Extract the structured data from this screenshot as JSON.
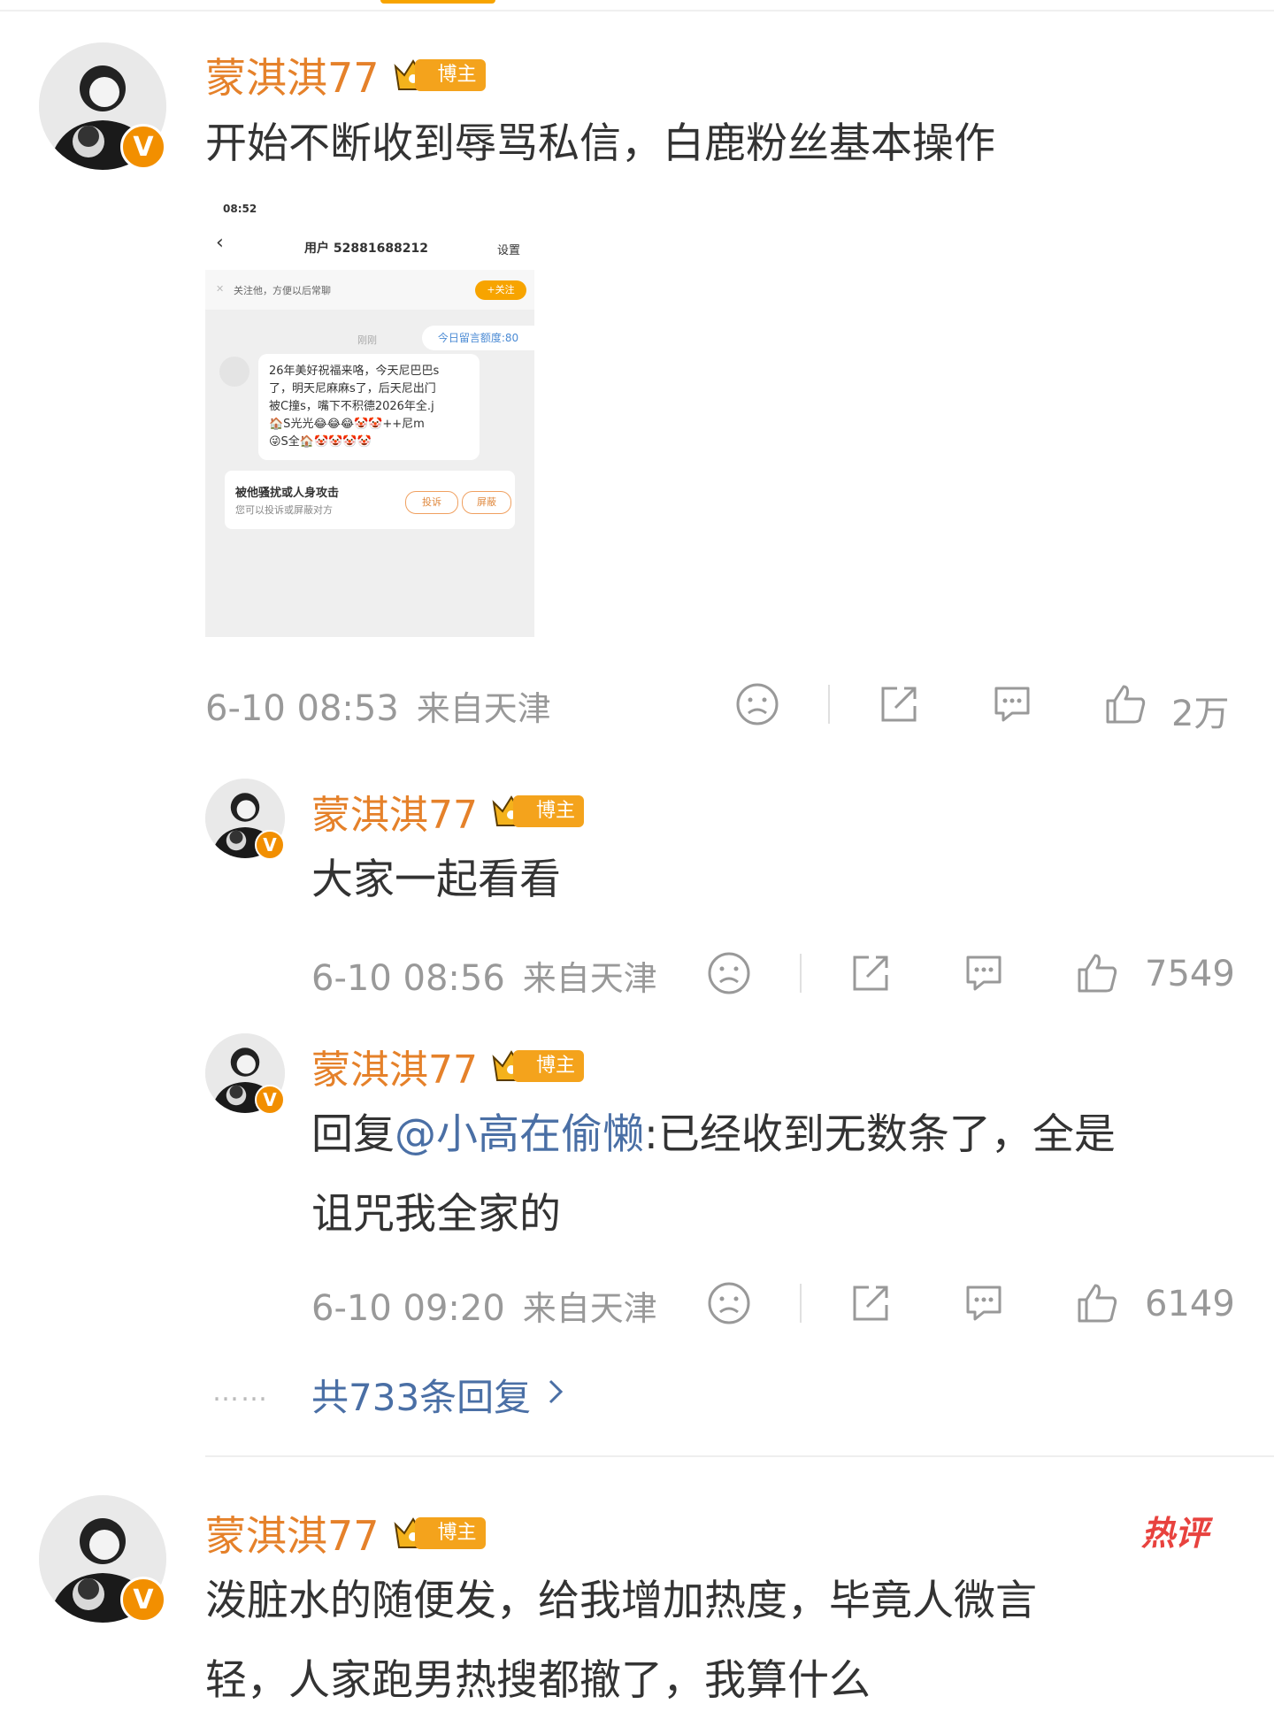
{
  "comments": [
    {
      "username": "蒙淇淇77",
      "badge": "博主",
      "verified": "V",
      "text": "开始不断收到辱骂私信，白鹿粉丝基本操作",
      "time": "6-10 08:53",
      "location": "来自天津",
      "likes": "2万"
    }
  ],
  "embedded_screenshot": {
    "time": "08:52",
    "title": "用户 52881688212",
    "settings": "设置",
    "follow_hint": "关注他，方便以后常聊",
    "follow_button": "+关注",
    "just_now": "刚刚",
    "quota": "今日留言额度:80",
    "message_lines": [
      "26年美好祝福来咯，今天尼巴巴s",
      "了，明天尼麻麻s了，后天尼出门",
      "被C撞s，嘴下不积德2026年全.j",
      "🏠S光光😂😂😂🤡🤡++尼m",
      "😜S全🏠🤡🤡🤡🤡"
    ],
    "report_title": "被他骚扰或人身攻击",
    "report_sub": "您可以投诉或屏蔽对方",
    "report_btn": "投诉",
    "block_btn": "屏蔽"
  },
  "replies": [
    {
      "username": "蒙淇淇77",
      "badge": "博主",
      "text": "大家一起看看",
      "time": "6-10 08:56",
      "location": "来自天津",
      "likes": "7549"
    },
    {
      "username": "蒙淇淇77",
      "badge": "博主",
      "reply_prefix": "回复",
      "mention": "@小高在偷懒",
      "text_line1": ":已经收到无数条了，全是",
      "text_line2": "诅咒我全家的",
      "time": "6-10 09:20",
      "location": "来自天津",
      "likes": "6149"
    }
  ],
  "more_replies": {
    "dots": "……",
    "label": "共733条回复",
    "chevron": "chevron-right-icon"
  },
  "comment2": {
    "username": "蒙淇淇77",
    "badge": "博主",
    "verified": "V",
    "hot_tag": "热评",
    "text_line1": "泼脏水的随便发，给我增加热度，毕竟人微言",
    "text_line2": "轻，人家跑男热搜都撤了，我算什么"
  },
  "icons": {
    "dislike": "sad-face-icon",
    "share": "share-icon",
    "comment": "comment-icon",
    "like": "thumbs-up-icon",
    "crown": "crown-icon"
  },
  "colors": {
    "username": "#e5812a",
    "link": "#4a6fa5",
    "meta": "#999999",
    "badge": "#f4a31c",
    "verified": "#f28f00",
    "hot": "#e8423e"
  }
}
